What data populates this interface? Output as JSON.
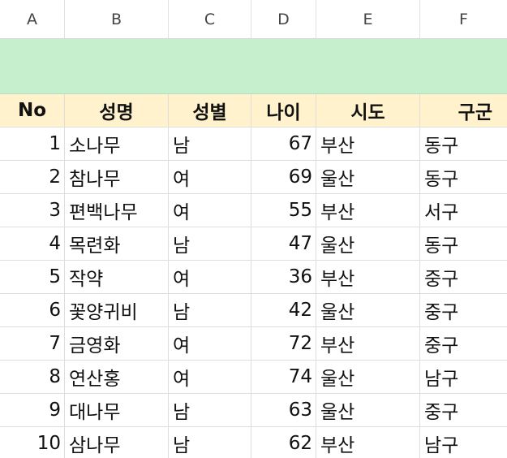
{
  "columns": [
    "A",
    "B",
    "C",
    "D",
    "E",
    "F"
  ],
  "table": {
    "headers": {
      "no": "No",
      "name": "성명",
      "gender": "성별",
      "age": "나이",
      "city": "시도",
      "district": "구군"
    },
    "rows": [
      {
        "no": "1",
        "name": "소나무",
        "gender": "남",
        "age": "67",
        "city": "부산",
        "district": "동구"
      },
      {
        "no": "2",
        "name": "참나무",
        "gender": "여",
        "age": "69",
        "city": "울산",
        "district": "동구"
      },
      {
        "no": "3",
        "name": "편백나무",
        "gender": "여",
        "age": "55",
        "city": "부산",
        "district": "서구"
      },
      {
        "no": "4",
        "name": "목련화",
        "gender": "남",
        "age": "47",
        "city": "울산",
        "district": "동구"
      },
      {
        "no": "5",
        "name": "작약",
        "gender": "여",
        "age": "36",
        "city": "부산",
        "district": "중구"
      },
      {
        "no": "6",
        "name": "꽃양귀비",
        "gender": "남",
        "age": "42",
        "city": "울산",
        "district": "중구"
      },
      {
        "no": "7",
        "name": "금영화",
        "gender": "여",
        "age": "72",
        "city": "부산",
        "district": "중구"
      },
      {
        "no": "8",
        "name": "연산홍",
        "gender": "여",
        "age": "74",
        "city": "울산",
        "district": "남구"
      },
      {
        "no": "9",
        "name": "대나무",
        "gender": "남",
        "age": "63",
        "city": "울산",
        "district": "중구"
      },
      {
        "no": "10",
        "name": "삼나무",
        "gender": "남",
        "age": "62",
        "city": "부산",
        "district": "남구"
      }
    ]
  },
  "colors": {
    "banner_fill": "#c6efce",
    "header_fill": "#fff2cc"
  }
}
